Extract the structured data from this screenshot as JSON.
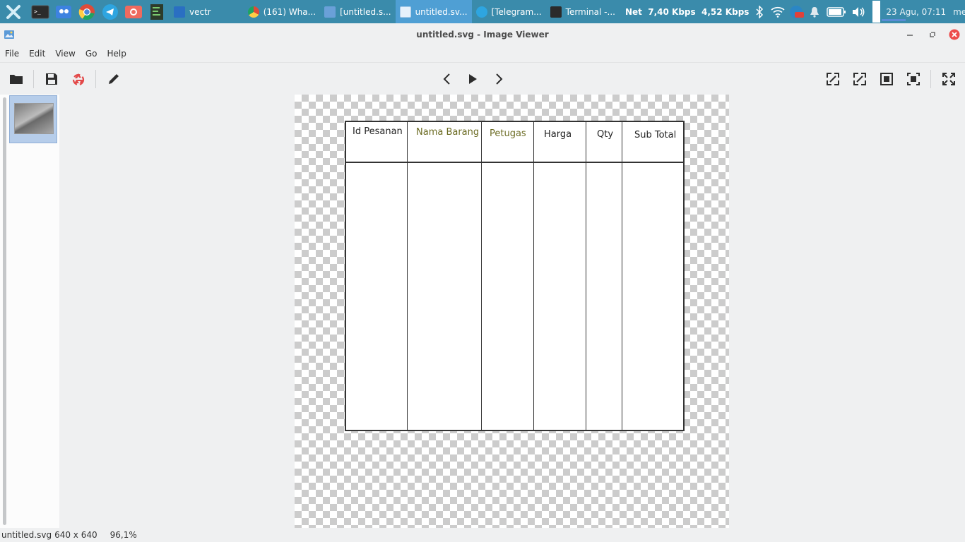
{
  "taskbar": {
    "tasks": [
      {
        "label": "vectr"
      },
      {
        "label": "(161) Wha..."
      },
      {
        "label": "[untitled.s..."
      },
      {
        "label": "untitled.sv..."
      },
      {
        "label": "[Telegram..."
      },
      {
        "label": "Terminal -..."
      }
    ],
    "network_label": "Net",
    "net_down": "7,40 Kbps",
    "net_up": "4,52 Kbps",
    "clock": "23 Agu, 07:11",
    "user": "melati"
  },
  "window": {
    "title": "untitled.svg - Image Viewer"
  },
  "menu": [
    "File",
    "Edit",
    "View",
    "Go",
    "Help"
  ],
  "document": {
    "headers": [
      "Id Pesanan",
      "Nama Barang",
      "Petugas",
      "Harga",
      "Qty",
      "Sub Total"
    ]
  },
  "status": {
    "filename": "untitled.svg",
    "dimensions": "640 x 640",
    "zoom": "96,1%"
  },
  "colors": {
    "taskbar": "#3a8bab",
    "active_task": "#4f9fd4",
    "header_green": "#6b6b22"
  }
}
